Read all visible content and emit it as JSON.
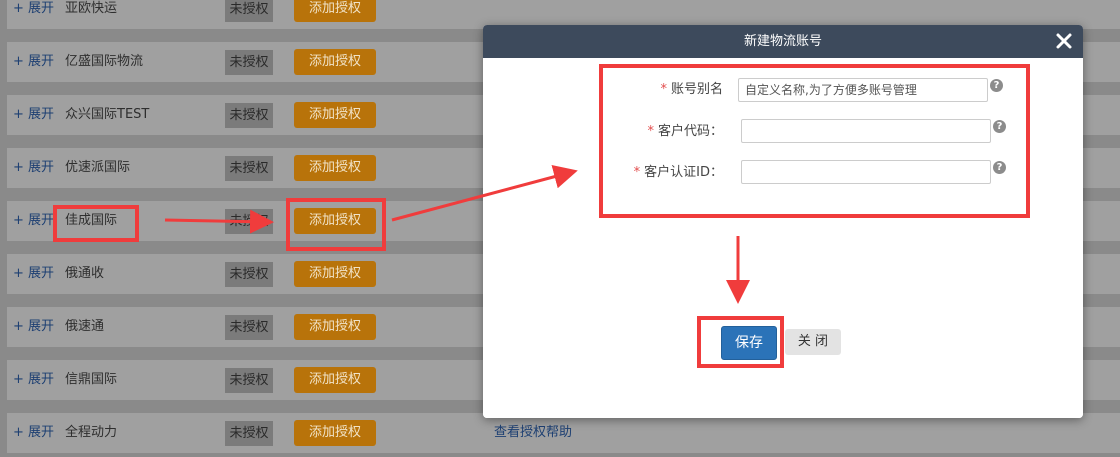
{
  "list": {
    "expand_label": "+ 展开",
    "status_label": "未授权",
    "auth_button_label": "添加授权",
    "help_link": "查看授权帮助",
    "rows": [
      {
        "name": "亚欧快运"
      },
      {
        "name": "亿盛国际物流"
      },
      {
        "name": "众兴国际TEST"
      },
      {
        "name": "优速派国际"
      },
      {
        "name": "佳成国际"
      },
      {
        "name": "俄通收"
      },
      {
        "name": "俄速通"
      },
      {
        "name": "信鼎国际"
      },
      {
        "name": "全程动力"
      }
    ]
  },
  "modal": {
    "title": "新建物流账号",
    "fields": [
      {
        "label": "账号别名",
        "required_mark": "*",
        "value": "",
        "placeholder": "自定义名称,为了方便多账号管理",
        "help": "?"
      },
      {
        "label": "客户代码：",
        "required_mark": "*",
        "value": "",
        "placeholder": "",
        "help": "?"
      },
      {
        "label": "客户认证ID：",
        "required_mark": "*",
        "value": "",
        "placeholder": "",
        "help": "?"
      }
    ],
    "save_label": "保存",
    "close_label": "关 闭"
  },
  "colors": {
    "header_bg": "#3d4a5c",
    "save_blue": "#2b73b8",
    "auth_orange": "#b8730a",
    "annotation_red": "#f03c3c"
  }
}
